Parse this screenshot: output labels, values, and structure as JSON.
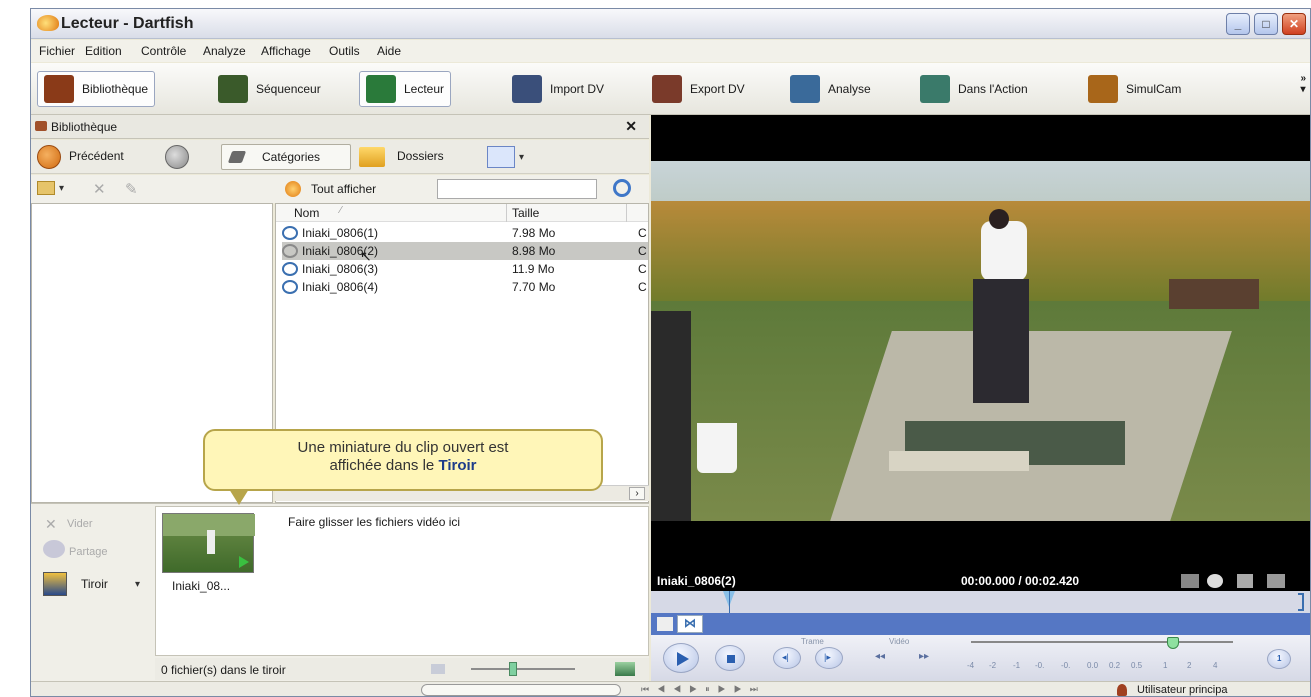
{
  "window": {
    "title": "Lecteur - Dartfish"
  },
  "menu": [
    "Fichier",
    "Edition",
    "Contrôle",
    "Analyze",
    "Affichage",
    "Outils",
    "Aide"
  ],
  "toolbar": [
    {
      "label": "Bibliothèque",
      "icon": "briefcase-icon",
      "color": "#8a3a18"
    },
    {
      "label": "Séquenceur",
      "icon": "sequencer-icon",
      "color": "#3a5a2a"
    },
    {
      "label": "Lecteur",
      "icon": "player-icon",
      "color": "#2a7a3a",
      "active": true
    },
    {
      "label": "Import DV",
      "icon": "camera-import-icon",
      "color": "#3a4f7a"
    },
    {
      "label": "Export DV",
      "icon": "camera-export-icon",
      "color": "#7a3a2a"
    },
    {
      "label": "Analyse",
      "icon": "analyse-icon",
      "color": "#3a6a9a"
    },
    {
      "label": "Dans l'Action",
      "icon": "action-icon",
      "color": "#3a7a6a"
    },
    {
      "label": "SimulCam",
      "icon": "simulcam-icon",
      "color": "#a8661a"
    }
  ],
  "library": {
    "title": "Bibliothèque",
    "back": "Précédent",
    "tab_categories": "Catégories",
    "tab_folders": "Dossiers",
    "show_all": "Tout afficher",
    "search_placeholder": "",
    "columns": {
      "name": "Nom",
      "size": "Taille"
    },
    "files": [
      {
        "name": "Iniaki_0806(1)",
        "size": "7.98 Mo",
        "extra": "C"
      },
      {
        "name": "Iniaki_0806(2)",
        "size": "8.98 Mo",
        "extra": "C",
        "selected": true
      },
      {
        "name": "Iniaki_0806(3)",
        "size": "11.9 Mo",
        "extra": "C"
      },
      {
        "name": "Iniaki_0806(4)",
        "size": "7.70 Mo",
        "extra": "C"
      }
    ]
  },
  "tooltip": {
    "line1": "Une miniature du clip ouvert est",
    "line2_pre": "affichée dans le ",
    "line2_bold": "Tiroir"
  },
  "drawer": {
    "clear": "Vider",
    "share": "Partage",
    "drawer_label": "Tiroir",
    "drop_hint": "Faire glisser les fichiers vidéo ici",
    "thumb_label": "Iniaki_08...",
    "status": "0 fichier(s) dans le tiroir"
  },
  "player": {
    "clip": "Iniaki_0806(2)",
    "time": "00:00.000 / 00:02.420",
    "frame_label": "Trame",
    "video_label": "Vidéo",
    "speed_ticks": [
      "-4",
      "-2",
      "-1",
      "-0.",
      "-0.",
      "0.0",
      "0.2",
      "0.5",
      "1",
      "2",
      "4"
    ],
    "speed_value": "1"
  },
  "status": {
    "user": "Utilisateur principa"
  }
}
